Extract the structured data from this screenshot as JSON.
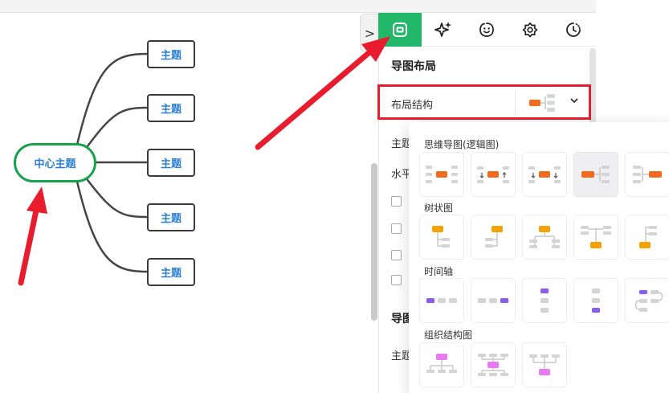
{
  "mindmap": {
    "central": "中心主题",
    "topics": [
      "主题",
      "主题",
      "主题",
      "主题",
      "主题"
    ]
  },
  "panel": {
    "collapse_glyph": ">",
    "tabs": [
      {
        "name": "tab-layout",
        "icon": "layout-frame-icon",
        "active": true
      },
      {
        "name": "tab-style",
        "icon": "sparkle-icon",
        "active": false
      },
      {
        "name": "tab-sticker",
        "icon": "smiley-icon",
        "active": false
      },
      {
        "name": "tab-theme",
        "icon": "flower-badge-icon",
        "active": false
      },
      {
        "name": "tab-history",
        "icon": "clock-icon",
        "active": false
      }
    ],
    "section_title": "导图布局",
    "layout_row_label": "布局结构",
    "background_labels": [
      "主题",
      "水平"
    ],
    "background_section": "导图",
    "background_row_label": "主题"
  },
  "dropdown": {
    "groups": [
      {
        "title": "思维导图(逻辑图)",
        "tiles": 5,
        "selected": 3
      },
      {
        "title": "树状图",
        "tiles": 5,
        "selected": -1
      },
      {
        "title": "时间轴",
        "tiles": 5,
        "selected": -1
      },
      {
        "title": "组织结构图",
        "tiles": 3,
        "selected": -1
      }
    ]
  },
  "colors": {
    "accent": "#22b86a",
    "highlight": "#e81c2c",
    "node_text": "#2a7fd4",
    "mindmap_orange": "#f26b1d",
    "tree_orange": "#f5a100",
    "timeline_purple": "#8a5cf5",
    "org_pink": "#e879f0"
  }
}
